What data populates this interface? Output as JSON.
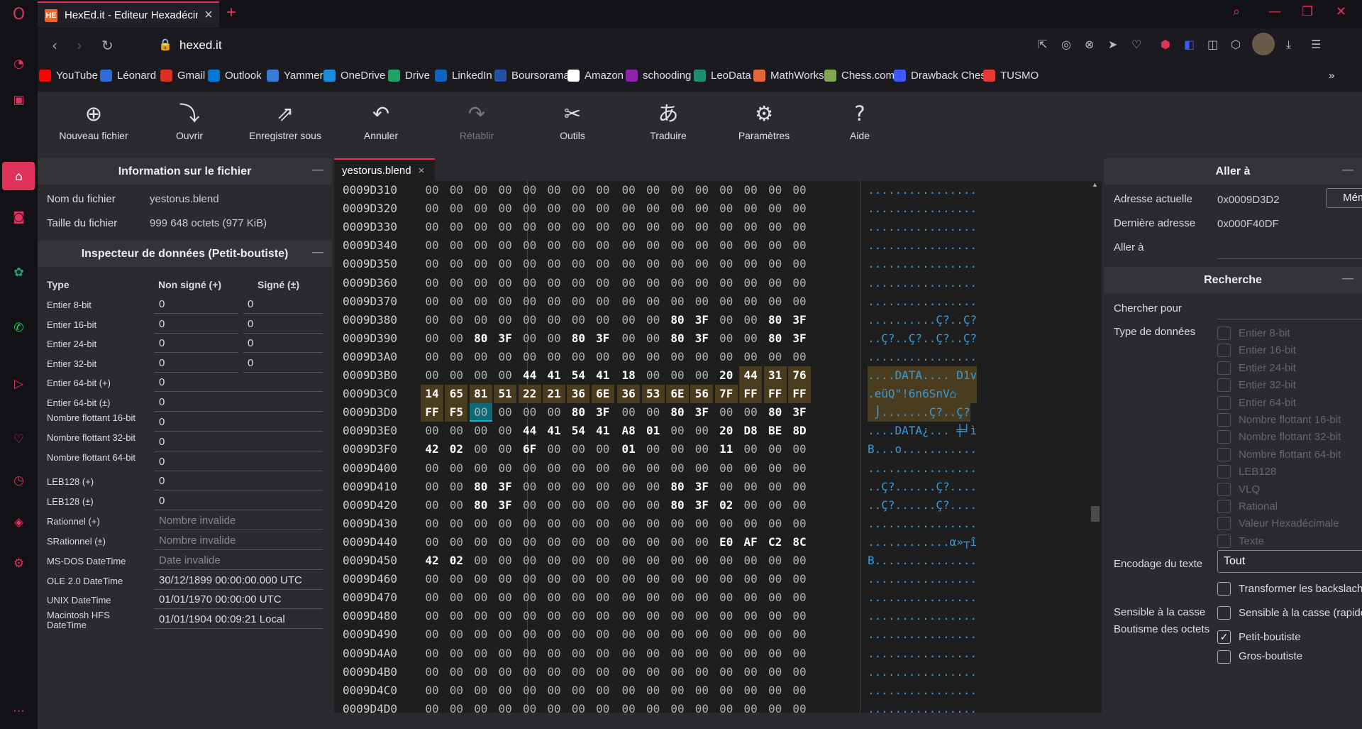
{
  "browser": {
    "tab_title": "HexEd.it - Editeur Hexadécimal",
    "tab_favicon": "HE",
    "url": "hexed.it",
    "accent": "#e0325a"
  },
  "bookmarks": [
    {
      "label": "YouTube",
      "color": "#ff0000"
    },
    {
      "label": "Léonard",
      "color": "#2e6bd6"
    },
    {
      "label": "Gmail",
      "color": "#d93025"
    },
    {
      "label": "Outlook",
      "color": "#0078d4"
    },
    {
      "label": "Yammer",
      "color": "#3a7bd5"
    },
    {
      "label": "OneDrive",
      "color": "#1b8cdb"
    },
    {
      "label": "Drive",
      "color": "#1ea362"
    },
    {
      "label": "LinkedIn",
      "color": "#0a66c2"
    },
    {
      "label": "Boursorama",
      "color": "#2450a6"
    },
    {
      "label": "Amazon",
      "color": "#ffffff"
    },
    {
      "label": "schooding",
      "color": "#8e24aa"
    },
    {
      "label": "LeoData",
      "color": "#1d8f6a"
    },
    {
      "label": "MathWorks",
      "color": "#e16737"
    },
    {
      "label": "Chess.com",
      "color": "#7fa650"
    },
    {
      "label": "Drawback Chess",
      "color": "#3d5afe"
    },
    {
      "label": "TUSMO",
      "color": "#e53935"
    }
  ],
  "toolbar": [
    {
      "label": "Nouveau fichier",
      "icon": "new-file-icon",
      "disabled": false
    },
    {
      "label": "Ouvrir",
      "icon": "open-icon",
      "disabled": false
    },
    {
      "label": "Enregistrer sous",
      "icon": "save-as-icon",
      "disabled": false
    },
    {
      "label": "Annuler",
      "icon": "undo-icon",
      "disabled": false
    },
    {
      "label": "Rétablir",
      "icon": "redo-icon",
      "disabled": true
    },
    {
      "label": "Outils",
      "icon": "tools-icon",
      "disabled": false
    },
    {
      "label": "Traduire",
      "icon": "translate-icon",
      "disabled": false
    },
    {
      "label": "Paramètres",
      "icon": "gear-icon",
      "disabled": false
    },
    {
      "label": "Aide",
      "icon": "help-icon",
      "disabled": false
    }
  ],
  "file_info": {
    "title": "Information sur le fichier",
    "name_label": "Nom du fichier",
    "name_value": "yestorus.blend",
    "size_label": "Taille du fichier",
    "size_value": "999 648 octets (977 KiB)"
  },
  "inspector": {
    "title": "Inspecteur de données (Petit-boutiste)",
    "col_type": "Type",
    "col_unsigned": "Non signé (+)",
    "col_signed": "Signé (±)",
    "rows": [
      {
        "label": "Entier 8-bit",
        "unsigned": "0",
        "signed": "0"
      },
      {
        "label": "Entier 16-bit",
        "unsigned": "0",
        "signed": "0"
      },
      {
        "label": "Entier 24-bit",
        "unsigned": "0",
        "signed": "0"
      },
      {
        "label": "Entier 32-bit",
        "unsigned": "0",
        "signed": "0"
      },
      {
        "label": "Entier 64-bit (+)",
        "value": "0"
      },
      {
        "label": "Entier 64-bit (±)",
        "value": "0"
      },
      {
        "label": "Nombre flottant 16-bit",
        "value": "0"
      },
      {
        "label": "Nombre flottant 32-bit",
        "value": "0"
      },
      {
        "label": "Nombre flottant 64-bit",
        "value": "0"
      },
      {
        "label": "LEB128 (+)",
        "value": "0"
      },
      {
        "label": "LEB128 (±)",
        "value": "0"
      },
      {
        "label": "Rationnel (+)",
        "placeholder": "Nombre invalide"
      },
      {
        "label": "SRationnel (±)",
        "placeholder": "Nombre invalide"
      },
      {
        "label": "MS-DOS DateTime",
        "placeholder": "Date invalide"
      },
      {
        "label": "OLE 2.0 DateTime",
        "value": "30/12/1899 00:00:00.000 UTC"
      },
      {
        "label": "UNIX DateTime",
        "value": "01/01/1970 00:00:00 UTC"
      },
      {
        "label": "Macintosh HFS DateTime",
        "value": "01/01/1904 00:09:21 Local"
      }
    ]
  },
  "hex": {
    "file_tab": "yestorus.blend",
    "selected_offset": "0009D3D2",
    "rows": [
      {
        "addr": "0009D310",
        "bytes": "00 00 00 00 00 00 00 00 00 00 00 00 00 00 00 00",
        "ascii": "................"
      },
      {
        "addr": "0009D320",
        "bytes": "00 00 00 00 00 00 00 00 00 00 00 00 00 00 00 00",
        "ascii": "................"
      },
      {
        "addr": "0009D330",
        "bytes": "00 00 00 00 00 00 00 00 00 00 00 00 00 00 00 00",
        "ascii": "................"
      },
      {
        "addr": "0009D340",
        "bytes": "00 00 00 00 00 00 00 00 00 00 00 00 00 00 00 00",
        "ascii": "................"
      },
      {
        "addr": "0009D350",
        "bytes": "00 00 00 00 00 00 00 00 00 00 00 00 00 00 00 00",
        "ascii": "................"
      },
      {
        "addr": "0009D360",
        "bytes": "00 00 00 00 00 00 00 00 00 00 00 00 00 00 00 00",
        "ascii": "................"
      },
      {
        "addr": "0009D370",
        "bytes": "00 00 00 00 00 00 00 00 00 00 00 00 00 00 00 00",
        "ascii": "................"
      },
      {
        "addr": "0009D380",
        "bytes": "00 00 00 00 00 00 00 00 00 00 80 3F 00 00 80 3F",
        "ascii": "..........Ç?..Ç?"
      },
      {
        "addr": "0009D390",
        "bytes": "00 00 80 3F 00 00 80 3F 00 00 80 3F 00 00 80 3F",
        "ascii": "..Ç?..Ç?..Ç?..Ç?"
      },
      {
        "addr": "0009D3A0",
        "bytes": "00 00 00 00 00 00 00 00 00 00 00 00 00 00 00 00",
        "ascii": "................"
      },
      {
        "addr": "0009D3B0",
        "bytes": "00 00 00 00 44 41 54 41 18 00 00 00 20 44 31 76",
        "ascii": "....DATA.... D1v",
        "hl_from": 13
      },
      {
        "addr": "0009D3C0",
        "bytes": "14 65 81 51 22 21 36 6E 36 53 6E 56 7F FF FF FF",
        "ascii": ".eüQ\"!6n6SnV⌂   ",
        "hl_from": 0
      },
      {
        "addr": "0009D3D0",
        "bytes": "FF F5 00 00 00 00 80 3F 00 00 80 3F 00 00 80 3F",
        "ascii": " ⌡.......Ç?..Ç?",
        "hl_to": 2,
        "sel": 2
      },
      {
        "addr": "0009D3E0",
        "bytes": "00 00 00 00 44 41 54 41 A8 01 00 00 20 D8 BE 8D",
        "ascii": "....DATA¿... ╪╛ì"
      },
      {
        "addr": "0009D3F0",
        "bytes": "42 02 00 00 6F 00 00 00 01 00 00 00 11 00 00 00",
        "ascii": "B...o..........."
      },
      {
        "addr": "0009D400",
        "bytes": "00 00 00 00 00 00 00 00 00 00 00 00 00 00 00 00",
        "ascii": "................"
      },
      {
        "addr": "0009D410",
        "bytes": "00 00 80 3F 00 00 00 00 00 00 80 3F 00 00 00 00",
        "ascii": "..Ç?......Ç?...."
      },
      {
        "addr": "0009D420",
        "bytes": "00 00 80 3F 00 00 00 00 00 00 80 3F 02 00 00 00",
        "ascii": "..Ç?......Ç?...."
      },
      {
        "addr": "0009D430",
        "bytes": "00 00 00 00 00 00 00 00 00 00 00 00 00 00 00 00",
        "ascii": "................"
      },
      {
        "addr": "0009D440",
        "bytes": "00 00 00 00 00 00 00 00 00 00 00 00 E0 AF C2 8C",
        "ascii": "............α»┬î"
      },
      {
        "addr": "0009D450",
        "bytes": "42 02 00 00 00 00 00 00 00 00 00 00 00 00 00 00",
        "ascii": "B..............."
      },
      {
        "addr": "0009D460",
        "bytes": "00 00 00 00 00 00 00 00 00 00 00 00 00 00 00 00",
        "ascii": "................"
      },
      {
        "addr": "0009D470",
        "bytes": "00 00 00 00 00 00 00 00 00 00 00 00 00 00 00 00",
        "ascii": "................"
      },
      {
        "addr": "0009D480",
        "bytes": "00 00 00 00 00 00 00 00 00 00 00 00 00 00 00 00",
        "ascii": "................"
      },
      {
        "addr": "0009D490",
        "bytes": "00 00 00 00 00 00 00 00 00 00 00 00 00 00 00 00",
        "ascii": "................"
      },
      {
        "addr": "0009D4A0",
        "bytes": "00 00 00 00 00 00 00 00 00 00 00 00 00 00 00 00",
        "ascii": "................"
      },
      {
        "addr": "0009D4B0",
        "bytes": "00 00 00 00 00 00 00 00 00 00 00 00 00 00 00 00",
        "ascii": "................"
      },
      {
        "addr": "0009D4C0",
        "bytes": "00 00 00 00 00 00 00 00 00 00 00 00 00 00 00 00",
        "ascii": "................"
      },
      {
        "addr": "0009D4D0",
        "bytes": "00 00 00 00 00 00 00 00 00 00 00 00 00 00 00 00",
        "ascii": "................"
      }
    ]
  },
  "goto": {
    "title": "Aller à",
    "current_label": "Adresse actuelle",
    "current_value": "0x0009D3D2",
    "memo_button": "Mémo",
    "last_label": "Dernière adresse",
    "last_value": "0x000F40DF",
    "goto_label": "Aller à"
  },
  "search": {
    "title": "Recherche",
    "find_label": "Chercher pour",
    "types_label": "Type de données",
    "types": [
      "Entier 8-bit",
      "Entier 16-bit",
      "Entier 24-bit",
      "Entier 32-bit",
      "Entier 64-bit",
      "Nombre flottant 16-bit",
      "Nombre flottant 32-bit",
      "Nombre flottant 64-bit",
      "LEB128",
      "VLQ",
      "Rational",
      "Valeur Hexadécimale",
      "Texte"
    ],
    "encoding_label": "Encodage du texte",
    "encoding_value": "Tout",
    "backslash_label": "Transformer les backslaches...",
    "case_label": "Sensible à la casse",
    "case_option": "Sensible à la casse (rapide)",
    "endian_label": "Boutisme des octets",
    "endian_little": "Petit-boutiste",
    "endian_big": "Gros-boutiste"
  }
}
